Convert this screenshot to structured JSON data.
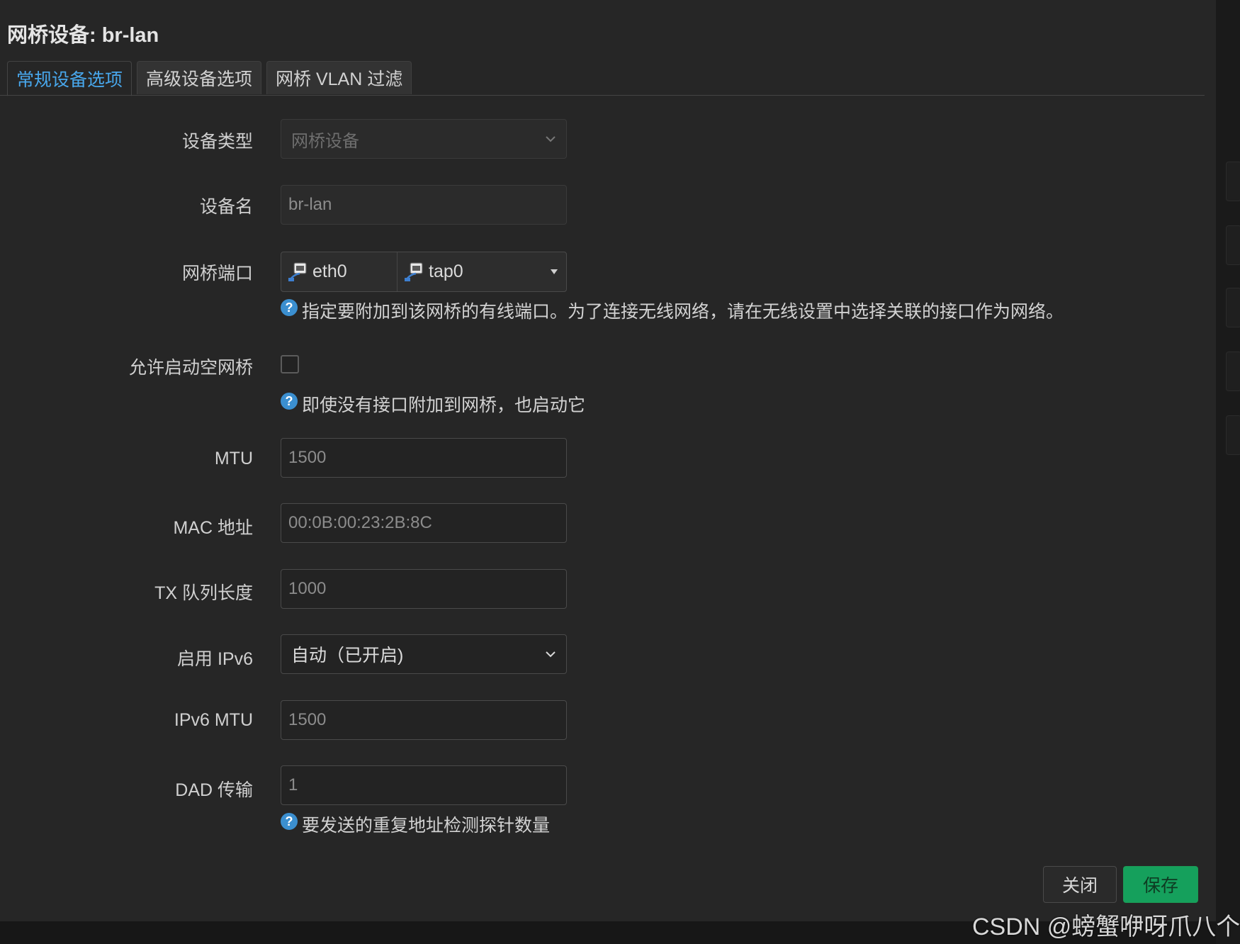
{
  "dialog": {
    "title": "网桥设备: br-lan"
  },
  "tabs": [
    {
      "label": "常规设备选项",
      "active": true
    },
    {
      "label": "高级设备选项",
      "active": false
    },
    {
      "label": "网桥 VLAN 过滤",
      "active": false
    }
  ],
  "form": {
    "device_type": {
      "label": "设备类型",
      "value": "网桥设备"
    },
    "device_name": {
      "label": "设备名",
      "placeholder": "br-lan"
    },
    "bridge_ports": {
      "label": "网桥端口",
      "ports": [
        "eth0",
        "tap0"
      ],
      "help": "指定要附加到该网桥的有线端口。为了连接无线网络，请在无线设置中选择关联的接口作为网络。"
    },
    "bring_up_empty": {
      "label": "允许启动空网桥",
      "checked": false,
      "help": "即使没有接口附加到网桥，也启动它"
    },
    "mtu": {
      "label": "MTU",
      "placeholder": "1500"
    },
    "mac": {
      "label": "MAC 地址",
      "placeholder": "00:0B:00:23:2B:8C"
    },
    "txqueuelen": {
      "label": "TX 队列长度",
      "placeholder": "1000"
    },
    "ipv6": {
      "label": "启用 IPv6",
      "value": "自动（已开启)"
    },
    "ipv6_mtu": {
      "label": "IPv6 MTU",
      "placeholder": "1500"
    },
    "dad": {
      "label": "DAD 传输",
      "placeholder": "1",
      "help": "要发送的重复地址检测探针数量"
    }
  },
  "help_icon_glyph": "?",
  "buttons": {
    "close": "关闭",
    "save": "保存"
  },
  "colors": {
    "accent": "#48a7ec",
    "save": "#15a05c",
    "help_icon": "#3b8fd0"
  },
  "watermark": "CSDN @螃蟹咿呀爪八个"
}
